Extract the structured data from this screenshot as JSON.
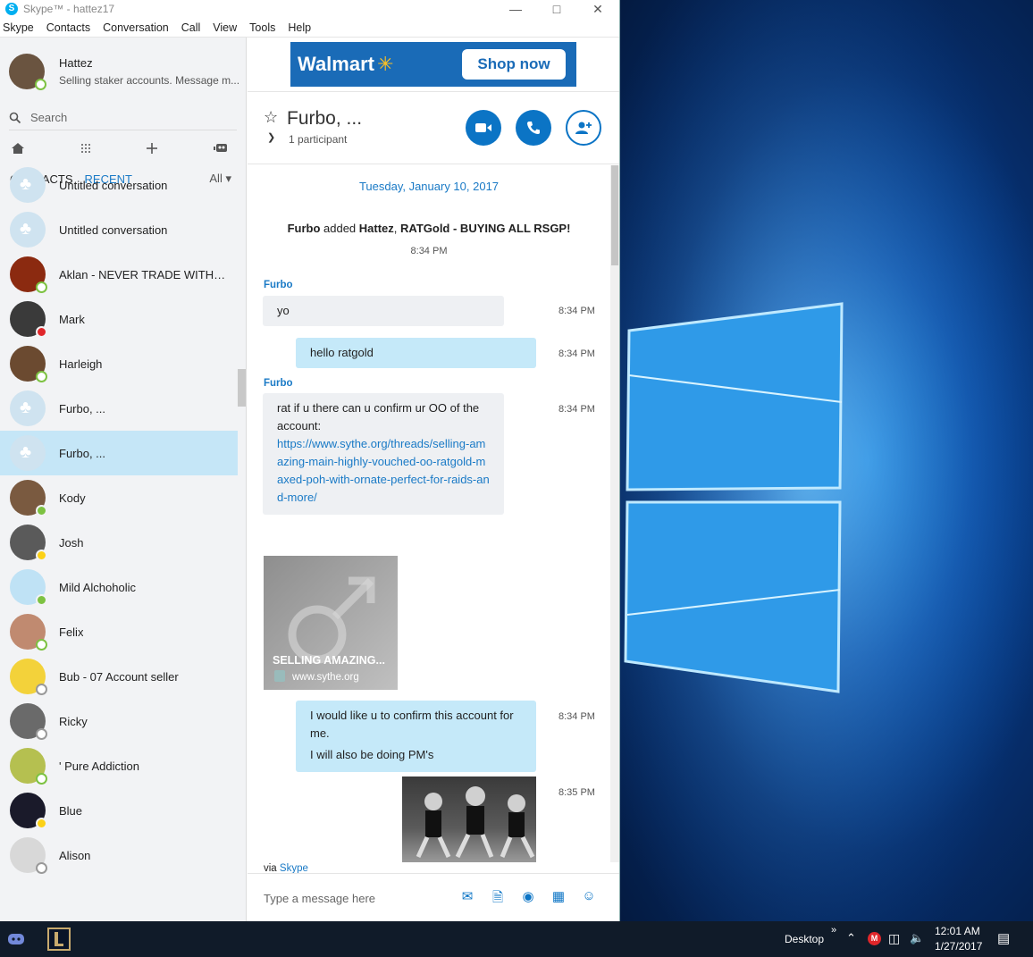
{
  "window": {
    "title": "Skype™ - hattez17",
    "minimize": "—",
    "maximize": "□",
    "close": "✕"
  },
  "menu": [
    "Skype",
    "Contacts",
    "Conversation",
    "Call",
    "View",
    "Tools",
    "Help"
  ],
  "profile": {
    "name": "Hattez",
    "mood": "Selling staker accounts. Message m..."
  },
  "search": {
    "placeholder": "Search"
  },
  "tabs": {
    "contacts": "CONTACTS",
    "recent": "RECENT",
    "filter": "All"
  },
  "contacts": [
    {
      "name": "Untitled conversation",
      "type": "group"
    },
    {
      "name": "Untitled conversation",
      "type": "group"
    },
    {
      "name": "Aklan - NEVER TRADE WITHO...",
      "status": "online",
      "color": "#8b2a10"
    },
    {
      "name": "Mark",
      "status": "busy",
      "color": "#3a3a3a"
    },
    {
      "name": "Harleigh",
      "status": "online",
      "color": "#6b4a30"
    },
    {
      "name": "Furbo, ...",
      "type": "group"
    },
    {
      "name": "Furbo, ...",
      "type": "group",
      "selected": true
    },
    {
      "name": "Kody",
      "status": "online-check",
      "color": "#7a5a40"
    },
    {
      "name": "Josh",
      "status": "away",
      "color": "#5a5a5a"
    },
    {
      "name": "Mild Alchoholic",
      "status": "online-check",
      "color": "#bfe2f5"
    },
    {
      "name": "Felix",
      "status": "online",
      "color": "#c08a70"
    },
    {
      "name": "Bub - 07 Account seller",
      "status": "unknown",
      "color": "#f3d23a"
    },
    {
      "name": "Ricky",
      "status": "unknown",
      "color": "#6a6a6a"
    },
    {
      "name": "' Pure Addiction",
      "status": "online",
      "color": "#b5c050"
    },
    {
      "name": "Blue",
      "status": "away",
      "color": "#1a1a2a"
    },
    {
      "name": "Alison",
      "status": "unknown",
      "color": "#d8d8d8"
    }
  ],
  "ad": {
    "brand": "Walmart",
    "cta": "Shop now"
  },
  "conversation": {
    "title": "Furbo, ...",
    "participants": "1 participant",
    "date": "Tuesday, January 10, 2017",
    "system": {
      "actor": "Furbo",
      "verb": " added ",
      "who": "Hattez",
      "sep": ", ",
      "group": "RATGold - BUYING ALL RSGP!"
    },
    "system_time": "8:34 PM",
    "messages": [
      {
        "sender": "Furbo",
        "text": "yo",
        "time": "8:34 PM"
      },
      {
        "text": "hello ratgold",
        "time": "8:34 PM"
      },
      {
        "sender": "Furbo",
        "text": "rat if u there can u confirm ur OO of the account:",
        "link": "https://www.sythe.org/threads/selling-amazing-main-highly-vouched-oo-ratgold-maxed-poh-with-ornate-perfect-for-raids-and-more/",
        "time": "8:34 PM"
      },
      {
        "text1": "I would like u to confirm this account for me.",
        "text2": "I will also be doing PM's",
        "time": "8:34 PM"
      },
      {
        "time": "8:35 PM"
      }
    ],
    "preview": {
      "title": "SELLING AMAZING...",
      "site": "www.sythe.org"
    },
    "via_prefix": "via ",
    "via_link": "Skype",
    "composer_placeholder": "Type a message here"
  },
  "taskbar": {
    "desktop_label": "Desktop",
    "time": "12:01 AM",
    "date": "1/27/2017"
  }
}
